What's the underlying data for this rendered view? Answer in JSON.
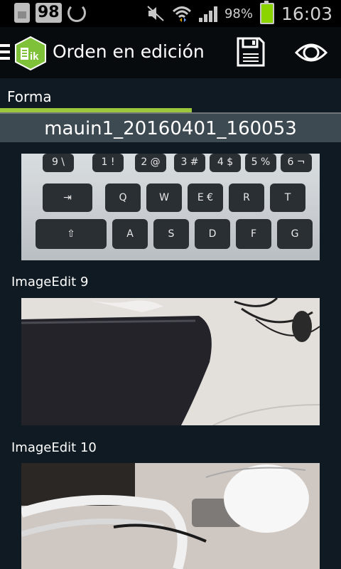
{
  "status_bar": {
    "notification_count": "98",
    "battery_percent": "98%",
    "time": "16:03"
  },
  "action_bar": {
    "title": "Orden en edición",
    "logo_text": "ik",
    "icons": [
      "menu-icon",
      "app-logo",
      "save-icon",
      "eye-icon"
    ]
  },
  "section": {
    "label": "Forma",
    "accent_color": "#9cc63b"
  },
  "record": {
    "name": "mauin1_20160401_160053"
  },
  "images": [
    {
      "label": ""
    },
    {
      "label": "ImageEdit 9"
    },
    {
      "label": "ImageEdit 10"
    }
  ],
  "keyboard_photo": {
    "row1": [
      "9 \\",
      "1 !",
      "2 @",
      "3 #",
      "4 $",
      "5 %",
      "6 ¬"
    ],
    "row2": [
      "⇥",
      "Q",
      "W",
      "E €",
      "R",
      "T"
    ],
    "row3": [
      "⇧",
      "A",
      "S",
      "D",
      "F",
      "G"
    ]
  }
}
